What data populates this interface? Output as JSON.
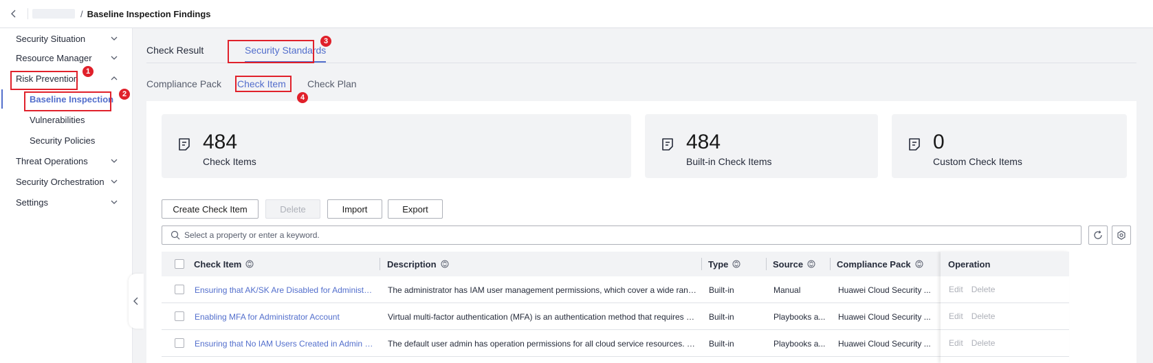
{
  "header": {
    "breadcrumb_separator": "/",
    "title": "Baseline Inspection Findings"
  },
  "sidebar": {
    "items": [
      {
        "label": "Security Situation"
      },
      {
        "label": "Resource Manager"
      },
      {
        "label": "Risk Prevention"
      },
      {
        "label": "Baseline Inspection"
      },
      {
        "label": "Vulnerabilities"
      },
      {
        "label": "Security Policies"
      },
      {
        "label": "Threat Operations"
      },
      {
        "label": "Security Orchestration"
      },
      {
        "label": "Settings"
      }
    ]
  },
  "tabs": {
    "check_result": "Check Result",
    "security_standards": "Security Standards"
  },
  "subtabs": {
    "compliance_pack": "Compliance Pack",
    "check_item": "Check Item",
    "check_plan": "Check Plan"
  },
  "stats": [
    {
      "value": "484",
      "label": "Check Items"
    },
    {
      "value": "484",
      "label": "Built-in Check Items"
    },
    {
      "value": "0",
      "label": "Custom Check Items"
    }
  ],
  "toolbar": {
    "create": "Create Check Item",
    "delete": "Delete",
    "import": "Import",
    "export": "Export"
  },
  "search": {
    "placeholder": "Select a property or enter a keyword."
  },
  "table": {
    "headers": {
      "check_item": "Check Item",
      "description": "Description",
      "type": "Type",
      "source": "Source",
      "compliance_pack": "Compliance Pack",
      "operation": "Operation"
    },
    "rows": [
      {
        "check_item": "Ensuring that AK/SK Are Disabled for Administrat...",
        "description": "The administrator has IAM user management permissions, which cover a wide range of...",
        "type": "Built-in",
        "source": "Manual",
        "compliance_pack": "Huawei Cloud Security ...",
        "edit": "Edit",
        "delete": "Delete"
      },
      {
        "check_item": "Enabling MFA for Administrator Account",
        "description": "Virtual multi-factor authentication (MFA) is an authentication method that requires users...",
        "type": "Built-in",
        "source": "Playbooks a...",
        "compliance_pack": "Huawei Cloud Security ...",
        "edit": "Edit",
        "delete": "Delete"
      },
      {
        "check_item": "Ensuring that No IAM Users Created in Admin Us...",
        "description": "The default user admin has operation permissions for all cloud service resources. It is i...",
        "type": "Built-in",
        "source": "Playbooks a...",
        "compliance_pack": "Huawei Cloud Security ...",
        "edit": "Edit",
        "delete": "Delete"
      }
    ]
  },
  "annotations": [
    "1",
    "2",
    "3",
    "4"
  ],
  "colors": {
    "accent": "#526ecc",
    "annotation": "#e0202a",
    "background": "#f2f3f5"
  }
}
